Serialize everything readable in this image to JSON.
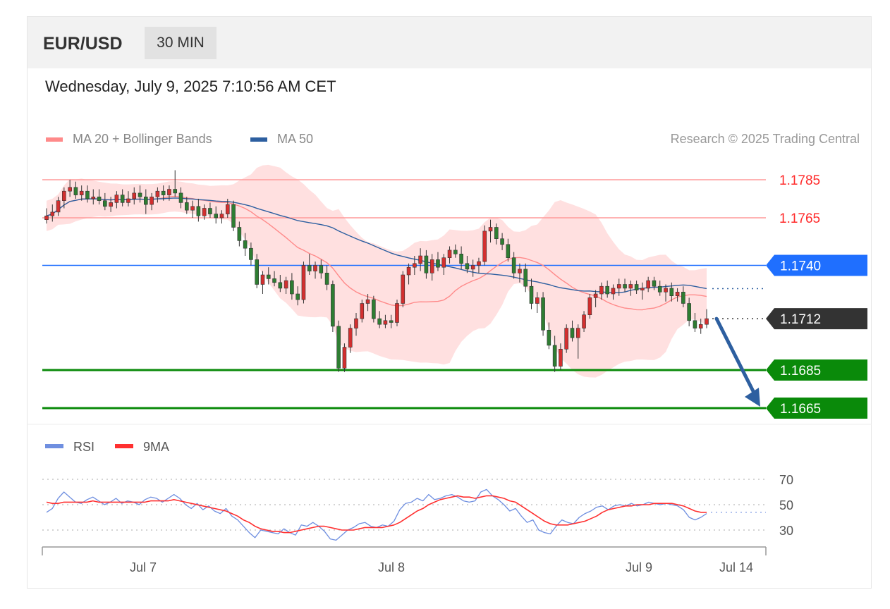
{
  "header": {
    "symbol": "EUR/USD",
    "timeframe": "30 MIN"
  },
  "datetime": "Wednesday, July 9, 2025 7:10:56 AM CET",
  "legend": [
    {
      "label": "MA 20 + Bollinger Bands",
      "color": "#ff8a8a"
    },
    {
      "label": "MA 50",
      "color": "#2d5fa0"
    }
  ],
  "copyright": "Research © 2025 Trading Central",
  "chart_data": [
    {
      "type": "candlestick",
      "price_levels": [
        {
          "label": "1.1785",
          "value": 1.1785,
          "kind": "resistance",
          "color": "#ff2b2b"
        },
        {
          "label": "1.1765",
          "value": 1.1765,
          "kind": "resistance",
          "color": "#ff2b2b"
        },
        {
          "label": "1.1740",
          "value": 1.174,
          "kind": "pivot",
          "color": "#1f6fff"
        },
        {
          "label": "1.1712",
          "value": 1.1712,
          "kind": "last",
          "color": "#333333"
        },
        {
          "label": "1.1685",
          "value": 1.1685,
          "kind": "support",
          "color": "#0a8a0a"
        },
        {
          "label": "1.1665",
          "value": 1.1665,
          "kind": "support",
          "color": "#0a8a0a"
        }
      ],
      "x_ticks": [
        "Jul 7",
        "Jul 8",
        "Jul 9",
        "Jul 14"
      ],
      "candle_colors": {
        "up": "#d32f2f",
        "down": "#2e7d32"
      },
      "forecast_arrow": {
        "from": 1.1712,
        "to": 1.1665,
        "direction": "down",
        "color": "#2d5fa0"
      },
      "candles": [
        [
          1.1764,
          1.177,
          1.1762,
          1.1766
        ],
        [
          1.1766,
          1.1772,
          1.1763,
          1.1768
        ],
        [
          1.1768,
          1.1776,
          1.1766,
          1.1774
        ],
        [
          1.1774,
          1.1781,
          1.177,
          1.1779
        ],
        [
          1.1779,
          1.1785,
          1.1776,
          1.1781
        ],
        [
          1.1781,
          1.1784,
          1.1775,
          1.1777
        ],
        [
          1.1777,
          1.1782,
          1.1774,
          1.1779
        ],
        [
          1.1779,
          1.1782,
          1.1773,
          1.1775
        ],
        [
          1.1775,
          1.178,
          1.1772,
          1.1776
        ],
        [
          1.1776,
          1.178,
          1.1772,
          1.1774
        ],
        [
          1.1774,
          1.1778,
          1.1769,
          1.1771
        ],
        [
          1.1771,
          1.1776,
          1.1768,
          1.1773
        ],
        [
          1.1773,
          1.1779,
          1.177,
          1.1777
        ],
        [
          1.1777,
          1.178,
          1.1771,
          1.1773
        ],
        [
          1.1773,
          1.1779,
          1.1771,
          1.1775
        ],
        [
          1.1775,
          1.1781,
          1.1772,
          1.1778
        ],
        [
          1.1778,
          1.1782,
          1.1773,
          1.1776
        ],
        [
          1.1776,
          1.178,
          1.1767,
          1.1772
        ],
        [
          1.1772,
          1.1778,
          1.1769,
          1.1776
        ],
        [
          1.1776,
          1.1781,
          1.1773,
          1.1779
        ],
        [
          1.1779,
          1.1782,
          1.1774,
          1.1777
        ],
        [
          1.1777,
          1.1782,
          1.1774,
          1.178
        ],
        [
          1.178,
          1.179,
          1.1776,
          1.1778
        ],
        [
          1.1778,
          1.1781,
          1.177,
          1.1773
        ],
        [
          1.1773,
          1.1776,
          1.1767,
          1.1769
        ],
        [
          1.1769,
          1.1774,
          1.1765,
          1.1771
        ],
        [
          1.1771,
          1.1775,
          1.1763,
          1.1766
        ],
        [
          1.1766,
          1.1772,
          1.1764,
          1.177
        ],
        [
          1.177,
          1.1773,
          1.1765,
          1.1767
        ],
        [
          1.1767,
          1.1771,
          1.1762,
          1.1765
        ],
        [
          1.1765,
          1.1769,
          1.1762,
          1.1767
        ],
        [
          1.1767,
          1.1775,
          1.1765,
          1.1772
        ],
        [
          1.1772,
          1.1774,
          1.1758,
          1.176
        ],
        [
          1.176,
          1.1763,
          1.175,
          1.1753
        ],
        [
          1.1753,
          1.1757,
          1.1745,
          1.1749
        ],
        [
          1.1749,
          1.1752,
          1.174,
          1.1743
        ],
        [
          1.1743,
          1.1746,
          1.1728,
          1.173
        ],
        [
          1.173,
          1.1737,
          1.1725,
          1.1735
        ],
        [
          1.1735,
          1.1739,
          1.173,
          1.1733
        ],
        [
          1.1733,
          1.1737,
          1.1729,
          1.1731
        ],
        [
          1.1731,
          1.1735,
          1.1726,
          1.1728
        ],
        [
          1.1728,
          1.1734,
          1.1725,
          1.1732
        ],
        [
          1.1732,
          1.1736,
          1.1722,
          1.1725
        ],
        [
          1.1725,
          1.1729,
          1.1719,
          1.1722
        ],
        [
          1.1722,
          1.1742,
          1.172,
          1.174
        ],
        [
          1.174,
          1.1746,
          1.1735,
          1.1737
        ],
        [
          1.1737,
          1.1742,
          1.1733,
          1.174
        ],
        [
          1.174,
          1.1743,
          1.1733,
          1.1736
        ],
        [
          1.1736,
          1.174,
          1.1727,
          1.173
        ],
        [
          1.173,
          1.1732,
          1.1705,
          1.1708
        ],
        [
          1.1708,
          1.1711,
          1.1684,
          1.1686
        ],
        [
          1.1686,
          1.1699,
          1.1684,
          1.1697
        ],
        [
          1.1697,
          1.1709,
          1.1694,
          1.1707
        ],
        [
          1.1707,
          1.1715,
          1.1703,
          1.1712
        ],
        [
          1.1712,
          1.1722,
          1.171,
          1.172
        ],
        [
          1.172,
          1.1725,
          1.1716,
          1.1722
        ],
        [
          1.1722,
          1.1724,
          1.171,
          1.1712
        ],
        [
          1.1712,
          1.1716,
          1.1707,
          1.1709
        ],
        [
          1.1709,
          1.1714,
          1.1707,
          1.1711
        ],
        [
          1.1711,
          1.1714,
          1.1707,
          1.171
        ],
        [
          1.171,
          1.1722,
          1.1708,
          1.172
        ],
        [
          1.172,
          1.1737,
          1.1718,
          1.1735
        ],
        [
          1.1735,
          1.1741,
          1.173,
          1.1739
        ],
        [
          1.1739,
          1.1745,
          1.1735,
          1.1741
        ],
        [
          1.1741,
          1.1749,
          1.1737,
          1.1745
        ],
        [
          1.1745,
          1.1748,
          1.1733,
          1.1736
        ],
        [
          1.1736,
          1.1746,
          1.1732,
          1.1743
        ],
        [
          1.1743,
          1.1747,
          1.1737,
          1.1739
        ],
        [
          1.1739,
          1.1746,
          1.1735,
          1.1744
        ],
        [
          1.1744,
          1.175,
          1.1741,
          1.1748
        ],
        [
          1.1748,
          1.1751,
          1.1744,
          1.1746
        ],
        [
          1.1746,
          1.175,
          1.1738,
          1.1741
        ],
        [
          1.1741,
          1.1745,
          1.1736,
          1.1738
        ],
        [
          1.1738,
          1.1743,
          1.1734,
          1.174
        ],
        [
          1.174,
          1.1744,
          1.1736,
          1.1742
        ],
        [
          1.1742,
          1.1761,
          1.174,
          1.1758
        ],
        [
          1.1758,
          1.1764,
          1.1752,
          1.176
        ],
        [
          1.176,
          1.1762,
          1.1751,
          1.1754
        ],
        [
          1.1754,
          1.1757,
          1.1748,
          1.1751
        ],
        [
          1.1751,
          1.1754,
          1.1742,
          1.1744
        ],
        [
          1.1744,
          1.1747,
          1.1733,
          1.1736
        ],
        [
          1.1736,
          1.1741,
          1.1731,
          1.1738
        ],
        [
          1.1738,
          1.1741,
          1.1726,
          1.1729
        ],
        [
          1.1729,
          1.1733,
          1.1717,
          1.172
        ],
        [
          1.172,
          1.1726,
          1.1715,
          1.1723
        ],
        [
          1.1723,
          1.1726,
          1.1703,
          1.1706
        ],
        [
          1.1706,
          1.171,
          1.1696,
          1.1698
        ],
        [
          1.1698,
          1.1703,
          1.1684,
          1.1687
        ],
        [
          1.1687,
          1.1699,
          1.1685,
          1.1696
        ],
        [
          1.1696,
          1.1709,
          1.1694,
          1.1707
        ],
        [
          1.1707,
          1.1711,
          1.17,
          1.1702
        ],
        [
          1.1702,
          1.1709,
          1.1691,
          1.1707
        ],
        [
          1.1707,
          1.1716,
          1.1705,
          1.1714
        ],
        [
          1.1714,
          1.1725,
          1.1712,
          1.1723
        ],
        [
          1.1723,
          1.1727,
          1.1718,
          1.1725
        ],
        [
          1.1725,
          1.1731,
          1.1722,
          1.1729
        ],
        [
          1.1729,
          1.1732,
          1.1723,
          1.1725
        ],
        [
          1.1725,
          1.173,
          1.1722,
          1.1728
        ],
        [
          1.1728,
          1.1733,
          1.1724,
          1.173
        ],
        [
          1.173,
          1.1733,
          1.1726,
          1.1728
        ],
        [
          1.1728,
          1.1732,
          1.1724,
          1.173
        ],
        [
          1.173,
          1.1732,
          1.1725,
          1.1727
        ],
        [
          1.1727,
          1.1731,
          1.1722,
          1.1728
        ],
        [
          1.1728,
          1.1734,
          1.1726,
          1.1732
        ],
        [
          1.1732,
          1.1734,
          1.1727,
          1.1729
        ],
        [
          1.1729,
          1.1732,
          1.1724,
          1.1726
        ],
        [
          1.1726,
          1.173,
          1.1721,
          1.1728
        ],
        [
          1.1728,
          1.1731,
          1.1721,
          1.1724
        ],
        [
          1.1724,
          1.1728,
          1.1721,
          1.1726
        ],
        [
          1.1726,
          1.1729,
          1.1718,
          1.172
        ],
        [
          1.172,
          1.1723,
          1.1708,
          1.1711
        ],
        [
          1.1711,
          1.1715,
          1.1705,
          1.1707
        ],
        [
          1.1707,
          1.1712,
          1.1704,
          1.1709
        ],
        [
          1.1709,
          1.1717,
          1.1707,
          1.1712
        ]
      ]
    },
    {
      "type": "line",
      "series": [
        {
          "name": "RSI",
          "color": "#6f8fe0"
        },
        {
          "name": "9MA",
          "color": "#ff3030"
        }
      ],
      "y_ticks": [
        70,
        50,
        30
      ],
      "last_value": 44,
      "rsi": [
        44,
        47,
        55,
        60,
        56,
        52,
        51,
        54,
        56,
        53,
        50,
        52,
        55,
        51,
        53,
        52,
        50,
        54,
        56,
        55,
        52,
        55,
        58,
        55,
        50,
        47,
        51,
        46,
        49,
        45,
        43,
        47,
        41,
        38,
        33,
        28,
        24,
        30,
        29,
        28,
        27,
        31,
        28,
        26,
        34,
        33,
        36,
        33,
        29,
        23,
        22,
        26,
        30,
        32,
        35,
        36,
        33,
        32,
        34,
        33,
        37,
        46,
        51,
        52,
        55,
        53,
        58,
        54,
        55,
        57,
        58,
        56,
        53,
        52,
        53,
        60,
        62,
        57,
        54,
        50,
        45,
        47,
        41,
        36,
        38,
        30,
        28,
        27,
        33,
        38,
        36,
        35,
        40,
        43,
        45,
        48,
        49,
        46,
        49,
        50,
        49,
        51,
        49,
        50,
        52,
        51,
        50,
        51,
        50,
        49,
        46,
        40,
        38,
        40,
        43
      ],
      "ma9": [
        52,
        51,
        51,
        52,
        52,
        52,
        52,
        52,
        53,
        52,
        52,
        52,
        52,
        52,
        52,
        52,
        52,
        52,
        53,
        53,
        53,
        53,
        54,
        53,
        52,
        51,
        50,
        49,
        48,
        47,
        46,
        45,
        43,
        41,
        38,
        36,
        33,
        31,
        30,
        29,
        29,
        28,
        28,
        29,
        30,
        31,
        32,
        33,
        33,
        32,
        31,
        30,
        30,
        30,
        31,
        32,
        32,
        32,
        32,
        33,
        34,
        36,
        39,
        42,
        45,
        47,
        50,
        52,
        54,
        55,
        56,
        57,
        56,
        56,
        55,
        56,
        57,
        57,
        56,
        55,
        53,
        52,
        49,
        46,
        43,
        40,
        37,
        35,
        34,
        34,
        34,
        35,
        36,
        37,
        39,
        41,
        44,
        46,
        47,
        48,
        49,
        49,
        50,
        50,
        50,
        51,
        51,
        51,
        51,
        50,
        49,
        47,
        45,
        44,
        44
      ]
    }
  ]
}
